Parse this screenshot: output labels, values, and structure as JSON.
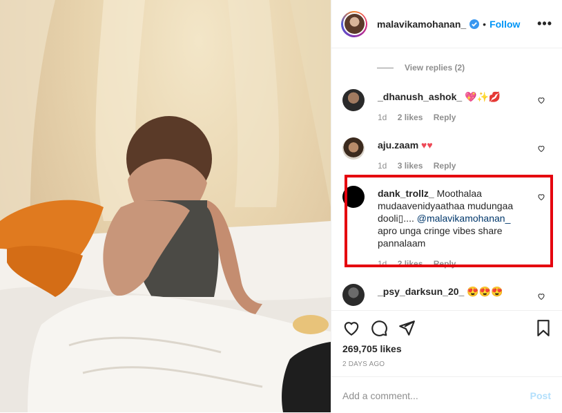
{
  "post": {
    "author": "malavikamohanan_",
    "dot": "•",
    "follow_label": "Follow",
    "more_label": "•••"
  },
  "comments": {
    "view_replies": "View replies (2)",
    "items": [
      {
        "user": "_dhanush_ashok_",
        "text": "💖✨💋",
        "time": "1d",
        "likes": "2 likes",
        "reply": "Reply"
      },
      {
        "user": "aju.zaam",
        "text": "♥♥",
        "time": "1d",
        "likes": "3 likes",
        "reply": "Reply"
      },
      {
        "user": "dank_trollz_",
        "text_a": "Moothalaa mudaavenidyaathaa mudungaa dooli▯.... ",
        "mention": "@malavikamohanan_",
        "text_b": " apro unga cringe vibes share pannalaam",
        "time": "1d",
        "likes": "2 likes",
        "reply": "Reply"
      },
      {
        "user": "_psy_darksun_20_",
        "text": "😍😍😍"
      }
    ]
  },
  "actions": {
    "likes": "269,705 likes",
    "posted_ago": "2 DAYS AGO"
  },
  "add_comment": {
    "placeholder": "Add a comment...",
    "post_label": "Post"
  },
  "colors": {
    "link_blue": "#0095f6",
    "highlight_red": "#e5000e",
    "muted": "#8e8e8e"
  }
}
